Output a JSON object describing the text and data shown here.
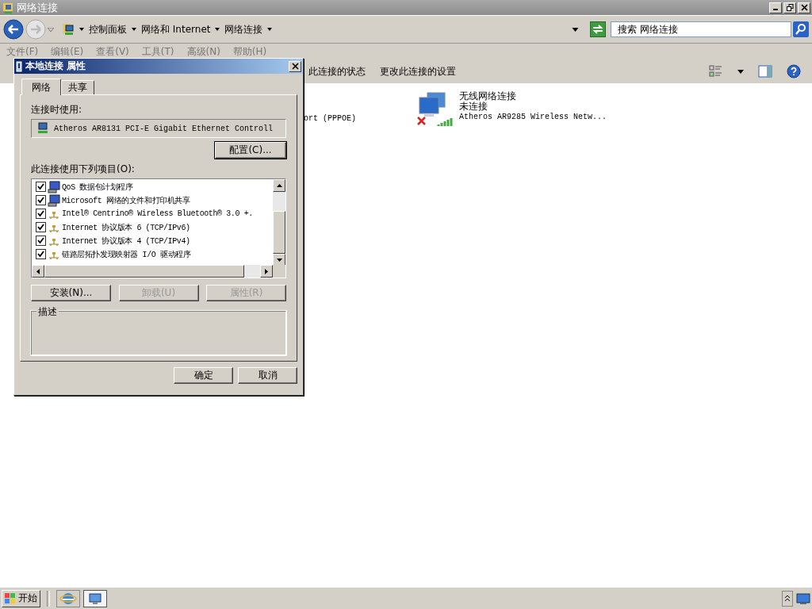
{
  "window": {
    "title": "网络连接"
  },
  "address": {
    "breadcrumb": [
      "控制面板",
      "网络和 Internet",
      "网络连接"
    ],
    "search_placeholder": "搜索 网络连接"
  },
  "menu": [
    "文件(F)",
    "编辑(E)",
    "查看(V)",
    "工具(T)",
    "高级(N)",
    "帮助(H)"
  ],
  "toolbar": [
    "此连接的状态",
    "更改此连接的设置"
  ],
  "partial_connection": {
    "device": "ort (PPPOE)"
  },
  "connections": [
    {
      "name": "无线网络连接",
      "status": "未连接",
      "device": "Atheros AR9285 Wireless Netw...",
      "disconnected": true
    }
  ],
  "dialog": {
    "title": "本地连接 属性",
    "tabs": [
      {
        "label": "网络",
        "selected": true
      },
      {
        "label": "共享",
        "selected": false
      }
    ],
    "connect_using_label": "连接时使用:",
    "adapter": "Atheros AR8131 PCI-E Gigabit Ethernet Controll",
    "configure_button": "配置(C)...",
    "items_label": "此连接使用下列项目(O):",
    "items": [
      {
        "label": "QoS 数据包计划程序",
        "checked": true,
        "kind": "service"
      },
      {
        "label": "Microsoft 网络的文件和打印机共享",
        "checked": true,
        "kind": "service"
      },
      {
        "label": "Intel® Centrino® Wireless Bluetooth® 3.0 +.",
        "checked": true,
        "kind": "protocol"
      },
      {
        "label": "Internet 协议版本 6 (TCP/IPv6)",
        "checked": true,
        "kind": "protocol"
      },
      {
        "label": "Internet 协议版本 4 (TCP/IPv4)",
        "checked": true,
        "kind": "protocol"
      },
      {
        "label": "链路层拓扑发现映射器 I/O 驱动程序",
        "checked": true,
        "kind": "protocol"
      }
    ],
    "item_buttons": [
      {
        "label": "安装(N)...",
        "disabled": false
      },
      {
        "label": "卸载(U)",
        "disabled": true
      },
      {
        "label": "属性(R)",
        "disabled": true
      }
    ],
    "description_label": "描述",
    "buttons": [
      "确定",
      "取消"
    ]
  },
  "taskbar": {
    "start": "开始"
  }
}
